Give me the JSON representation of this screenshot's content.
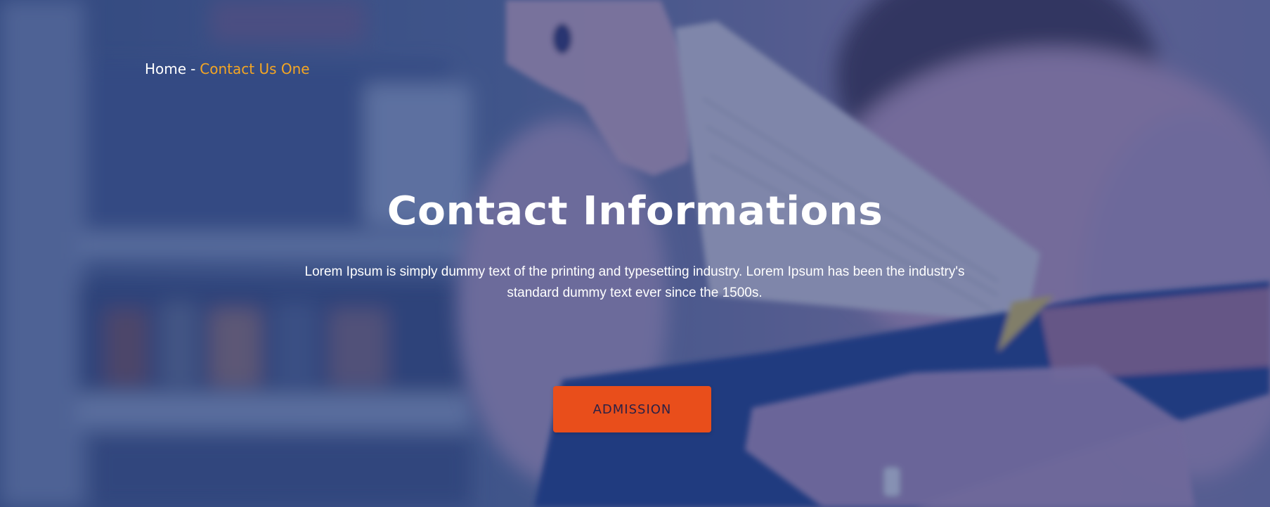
{
  "breadcrumb": {
    "home_label": "Home",
    "separator": "-",
    "current_label": "Contact Us One"
  },
  "hero": {
    "title": "Contact Informations",
    "description_line1": "Lorem Ipsum is simply dummy text of the printing and typesetting industry. Lorem Ipsum has been the industry's",
    "description_line2": "standard dummy text ever since the 1500s.",
    "button_label": "ADMISSION"
  },
  "colors": {
    "overlay": "#263c78",
    "accent_breadcrumb": "#f5a623",
    "button_bg": "#e94e1b",
    "button_text": "#2b2146",
    "text": "#ffffff"
  }
}
